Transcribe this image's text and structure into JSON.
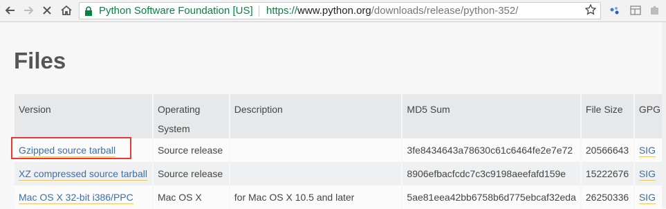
{
  "browser": {
    "ev_label": "Python Software Foundation [US]",
    "url_scheme": "https://",
    "url_host": "www.python.org",
    "url_path": "/downloads/release/python-352/"
  },
  "page": {
    "title": "Files"
  },
  "table": {
    "headers": [
      {
        "label": "Version"
      },
      {
        "label": "Operating System"
      },
      {
        "label": "Description"
      },
      {
        "label": "MD5 Sum"
      },
      {
        "label": "File Size"
      },
      {
        "label": "GPG"
      }
    ],
    "rows": [
      {
        "version": "Gzipped source tarball",
        "os": "Source release",
        "description": "",
        "md5": "3fe8434643a78630c61c6464fe2e7e72",
        "size": "20566643",
        "gpg": "SIG"
      },
      {
        "version": "XZ compressed source tarball",
        "os": "Source release",
        "description": "",
        "md5": "8906efbacfcdc7c3c9198aeefafd159e",
        "size": "15222676",
        "gpg": "SIG"
      },
      {
        "version": "Mac OS X 32-bit i386/PPC",
        "os": "Mac OS X",
        "description": "for Mac OS X 10.5 and later",
        "md5": "5ae81eea42bb6758b6d775ebcaf32eda",
        "size": "26250336",
        "gpg": "SIG"
      }
    ]
  },
  "colors": {
    "link": "#3a6fa8",
    "ev_green": "#0b8043",
    "highlight": "#e53935"
  }
}
